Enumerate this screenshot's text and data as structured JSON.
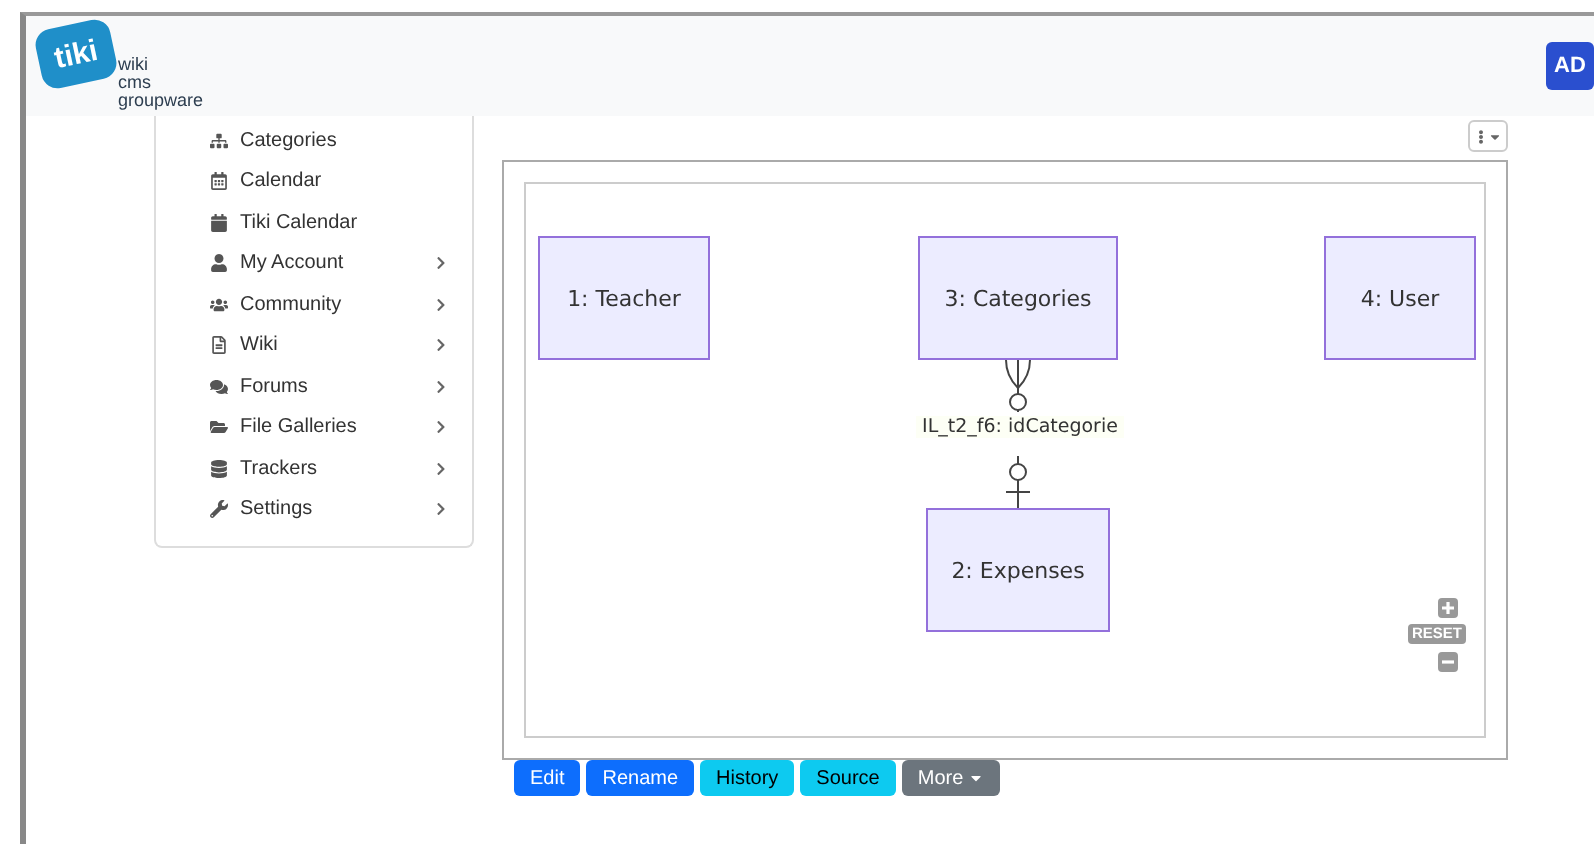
{
  "header": {
    "logo": {
      "mark": "tiki",
      "lines": [
        "wiki",
        "cms",
        "groupware"
      ]
    },
    "user_avatar": "AD"
  },
  "sidebar": {
    "items": [
      {
        "label": "Categories",
        "has_submenu": false
      },
      {
        "label": "Calendar",
        "has_submenu": false
      },
      {
        "label": "Tiki Calendar",
        "has_submenu": false
      },
      {
        "label": "My Account",
        "has_submenu": true
      },
      {
        "label": "Community",
        "has_submenu": true
      },
      {
        "label": "Wiki",
        "has_submenu": true
      },
      {
        "label": "Forums",
        "has_submenu": true
      },
      {
        "label": "File Galleries",
        "has_submenu": true
      },
      {
        "label": "Trackers",
        "has_submenu": true
      },
      {
        "label": "Settings",
        "has_submenu": true
      }
    ]
  },
  "diagram": {
    "entities": [
      {
        "label": "1: Teacher"
      },
      {
        "label": "3: Categories"
      },
      {
        "label": "4: User"
      },
      {
        "label": "2: Expenses"
      }
    ],
    "relationship": {
      "label": "IL_t2_f6: idCategorie"
    },
    "zoom_controls": {
      "reset": "RESET"
    }
  },
  "actions": [
    {
      "label": "Edit",
      "kind": "primary"
    },
    {
      "label": "Rename",
      "kind": "primary"
    },
    {
      "label": "History",
      "kind": "info"
    },
    {
      "label": "Source",
      "kind": "info"
    },
    {
      "label": "More",
      "kind": "secondary"
    }
  ]
}
